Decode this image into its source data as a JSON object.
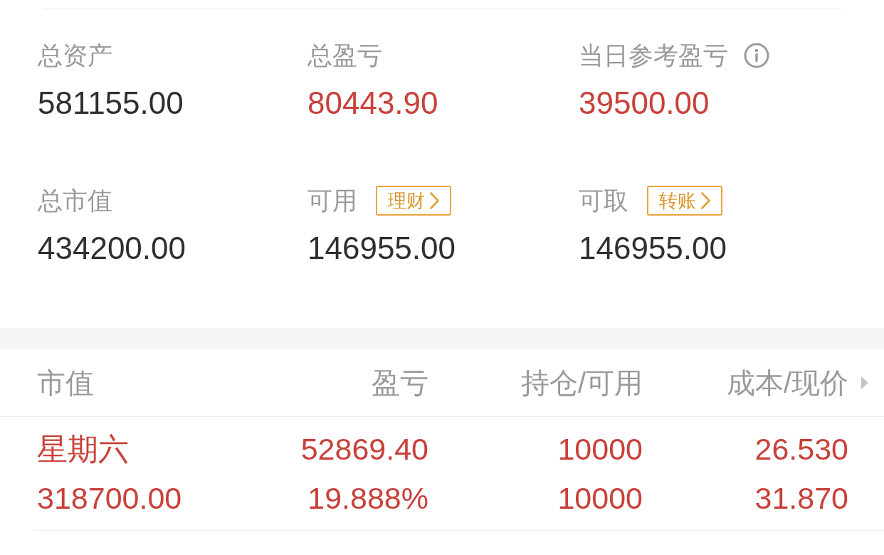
{
  "overview": {
    "items": [
      {
        "label": "总资产",
        "value": "581155.00",
        "profit": false,
        "info": false
      },
      {
        "label": "总盈亏",
        "value": "80443.90",
        "profit": true,
        "info": false
      },
      {
        "label": "当日参考盈亏",
        "value": "39500.00",
        "profit": true,
        "info": true
      },
      {
        "label": "总市值",
        "value": "434200.00",
        "profit": false,
        "info": false
      },
      {
        "label": "可用",
        "value": "146955.00",
        "profit": false,
        "info": false,
        "action": "理财"
      },
      {
        "label": "可取",
        "value": "146955.00",
        "profit": false,
        "info": false,
        "action": "转账"
      }
    ]
  },
  "positions": {
    "columns": [
      "市值",
      "盈亏",
      "持仓/可用",
      "成本/现价"
    ],
    "rows": [
      {
        "profit": true,
        "cells": [
          [
            "星期六",
            "318700.00"
          ],
          [
            "52869.40",
            "19.888%"
          ],
          [
            "10000",
            "10000"
          ],
          [
            "26.530",
            "31.870"
          ]
        ]
      }
    ]
  }
}
